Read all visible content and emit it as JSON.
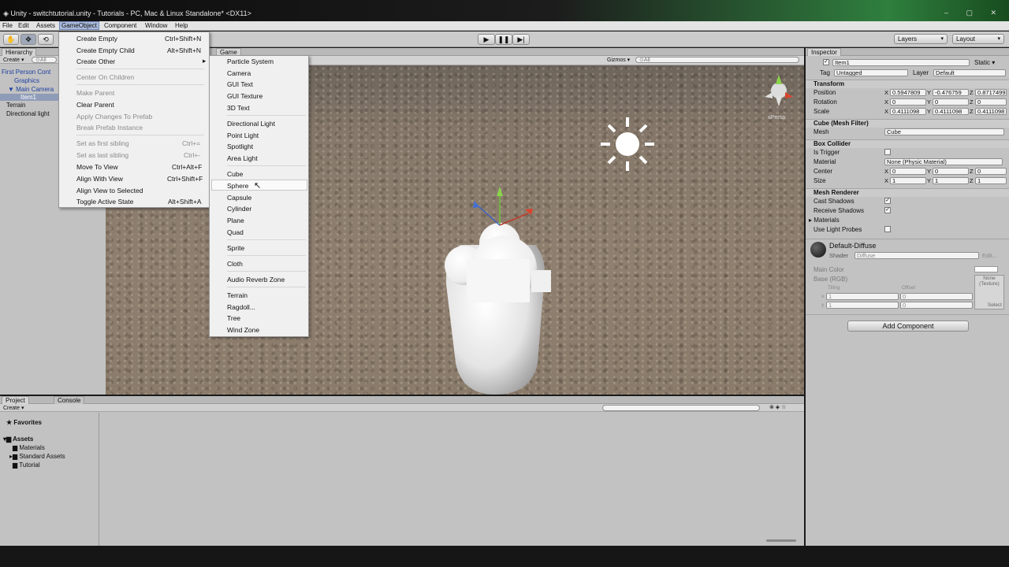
{
  "window": {
    "title": "Unity - switchtutorial.unity - Tutorials - PC, Mac & Linux Standalone* <DX11>",
    "controls": "–  ▢  ✕"
  },
  "menubar": [
    "File",
    "Edit",
    "Assets",
    "GameObject",
    "Component",
    "Window",
    "Help"
  ],
  "toolbar": {
    "layers": "Layers",
    "layout": "Layout",
    "play_icon": "play-icon",
    "pause_icon": "pause-icon",
    "step_icon": "step-icon"
  },
  "hierarchy": {
    "tab": "Hierarchy",
    "create": "Create ▾",
    "search": "⊙All",
    "items": [
      "First Person Cont",
      "Graphics",
      "▼ Main Camera",
      "Item1",
      "Terrain",
      "Directional light"
    ]
  },
  "scene": {
    "tab": "Game",
    "gizmos": "Gizmos ▾",
    "search": "⊙All",
    "persp": "≤Persp"
  },
  "gameobject_menu": {
    "items": [
      {
        "label": "Create Empty",
        "shortcut": "Ctrl+Shift+N",
        "disabled": false
      },
      {
        "label": "Create Empty Child",
        "shortcut": "Alt+Shift+N",
        "disabled": false
      },
      {
        "label": "Create Other",
        "shortcut": "",
        "disabled": false
      },
      {
        "label": "Center On Children",
        "shortcut": "",
        "disabled": true
      },
      {
        "label": "Make Parent",
        "shortcut": "",
        "disabled": true
      },
      {
        "label": "Clear Parent",
        "shortcut": "",
        "disabled": false
      },
      {
        "label": "Apply Changes To Prefab",
        "shortcut": "",
        "disabled": true
      },
      {
        "label": "Break Prefab Instance",
        "shortcut": "",
        "disabled": true
      },
      {
        "label": "Set as first sibling",
        "shortcut": "Ctrl+=",
        "disabled": true
      },
      {
        "label": "Set as last sibling",
        "shortcut": "Ctrl+-",
        "disabled": true
      },
      {
        "label": "Move To View",
        "shortcut": "Ctrl+Alt+F",
        "disabled": false
      },
      {
        "label": "Align With View",
        "shortcut": "Ctrl+Shift+F",
        "disabled": false
      },
      {
        "label": "Align View to Selected",
        "shortcut": "",
        "disabled": false
      },
      {
        "label": "Toggle Active State",
        "shortcut": "Alt+Shift+A",
        "disabled": false
      }
    ]
  },
  "create_other_menu": {
    "items": [
      "Particle System",
      "Camera",
      "GUI Text",
      "GUI Texture",
      "3D Text",
      "Directional Light",
      "Point Light",
      "Spotlight",
      "Area Light",
      "Cube",
      "Sphere",
      "Capsule",
      "Cylinder",
      "Plane",
      "Quad",
      "Sprite",
      "Cloth",
      "Audio Reverb Zone",
      "Terrain",
      "Ragdoll...",
      "Tree",
      "Wind Zone"
    ],
    "hovered": "Sphere"
  },
  "project": {
    "tabs": [
      "Project",
      "Console"
    ],
    "create": "Create ▾",
    "favorites": "Favorites",
    "assets": "Assets",
    "folders": [
      "Materials",
      "Standard Assets",
      "Tutorial"
    ]
  },
  "inspector": {
    "tab": "Inspector",
    "object_name": "Item1",
    "static_label": "Static ▾",
    "tag_label": "Tag",
    "tag_value": "Untagged",
    "layer_label": "Layer",
    "layer_value": "Default",
    "transform": {
      "title": "Transform",
      "position": {
        "label": "Position",
        "x": "0.5947809",
        "y": "-0.476759",
        "z": "0.8717499"
      },
      "rotation": {
        "label": "Rotation",
        "x": "0",
        "y": "0",
        "z": "0"
      },
      "scale": {
        "label": "Scale",
        "x": "0.4111098",
        "y": "0.4111098",
        "z": "0.4111098"
      }
    },
    "mesh_filter": {
      "title": "Cube (Mesh Filter)",
      "mesh_label": "Mesh",
      "mesh_value": "Cube"
    },
    "box_collider": {
      "title": "Box Collider",
      "is_trigger": "Is Trigger",
      "material_label": "Material",
      "material_value": "None (Physic Material)",
      "center_label": "Center",
      "center": {
        "x": "0",
        "y": "0",
        "z": "0"
      },
      "size_label": "Size",
      "size": {
        "x": "1",
        "y": "1",
        "z": "1"
      }
    },
    "mesh_renderer": {
      "title": "Mesh Renderer",
      "cast_shadows": "Cast Shadows",
      "receive_shadows": "Receive Shadows",
      "materials": "Materials",
      "use_light_probes": "Use Light Probes"
    },
    "material": {
      "name": "Default-Diffuse",
      "shader_label": "Shader",
      "shader_value": "Diffuse",
      "edit": "Edit...",
      "main_color": "Main Color",
      "base": "Base (RGB)",
      "tiling": "Tiling",
      "offset": "Offset",
      "texture_none": "None (Texture)",
      "select": "Select",
      "x": "x",
      "y": "y",
      "tiling_x": "1",
      "tiling_y": "1",
      "offset_x": "0",
      "offset_y": "0"
    },
    "add_component": "Add Component"
  },
  "axes": {
    "x": "X",
    "y": "Y",
    "z": "Z"
  }
}
